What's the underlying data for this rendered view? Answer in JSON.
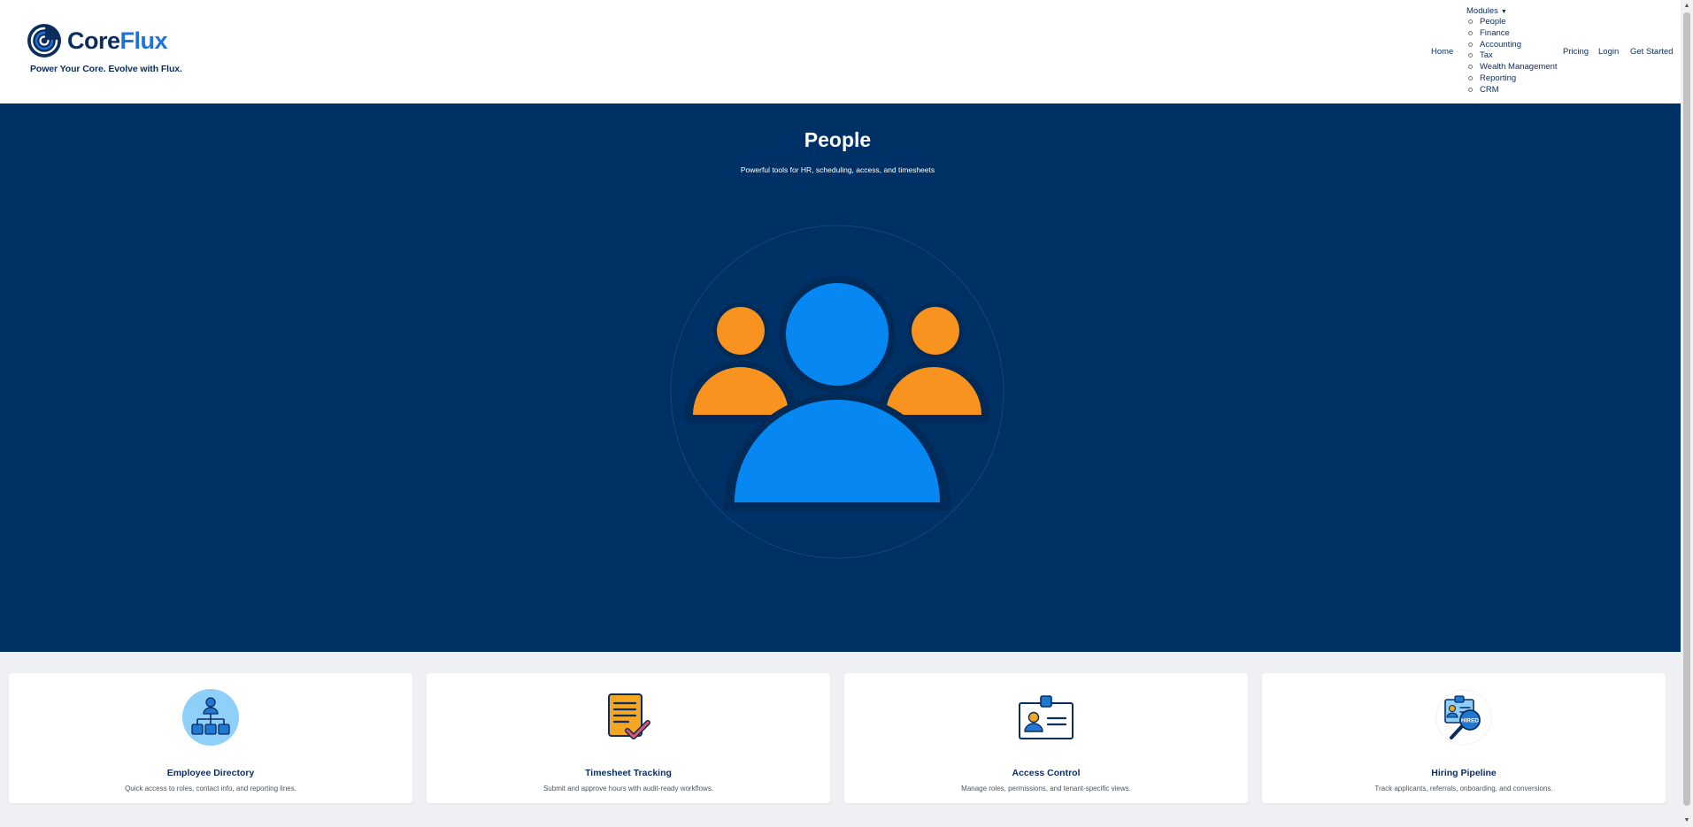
{
  "brand": {
    "name_core": "Core",
    "name_flux": "Flux",
    "tagline": "Power Your Core. Evolve with Flux.",
    "colors": {
      "navy": "#0b2d5e",
      "blue": "#1e73d8"
    }
  },
  "nav": {
    "home": "Home",
    "modules_label": "Modules",
    "modules": [
      "People",
      "Finance",
      "Accounting",
      "Tax",
      "Wealth Management",
      "Reporting",
      "CRM"
    ],
    "pricing": "Pricing",
    "login": "Login",
    "get_started": "Get Started"
  },
  "hero": {
    "title": "People",
    "subtitle": "Powerful tools for HR, scheduling, access, and timesheets",
    "background": "#003166",
    "illustration_icon": "people-group-icon",
    "colors": {
      "primary_person": "#0787f2",
      "secondary_person": "#f7931e"
    }
  },
  "features": [
    {
      "icon": "org-chart-icon",
      "title": "Employee Directory",
      "description": "Quick access to roles, contact info, and reporting lines."
    },
    {
      "icon": "timesheet-check-icon",
      "title": "Timesheet Tracking",
      "description": "Submit and approve hours with audit-ready workflows."
    },
    {
      "icon": "id-badge-icon",
      "title": "Access Control",
      "description": "Manage roles, permissions, and tenant-specific views."
    },
    {
      "icon": "hiring-search-icon",
      "title": "Hiring Pipeline",
      "description": "Track applicants, referrals, onboarding, and conversions."
    }
  ],
  "hiring_badge_text": "HIRED"
}
